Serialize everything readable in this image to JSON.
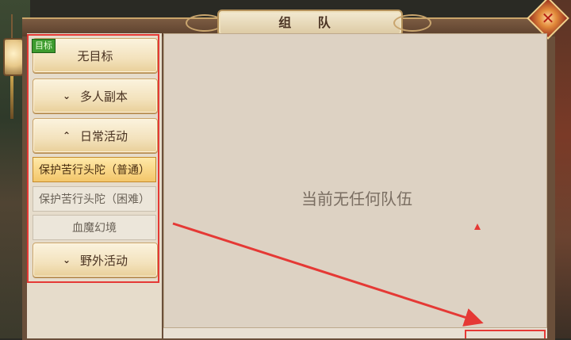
{
  "window": {
    "title": "组 队",
    "close_icon": "close-icon"
  },
  "left_menu": {
    "goal_tag": "目标",
    "items": [
      {
        "label": "无目标",
        "chevron": ""
      },
      {
        "label": "多人副本",
        "chevron": "⌄"
      },
      {
        "label": "日常活动",
        "chevron": "⌃"
      }
    ],
    "sub_items": [
      {
        "label": "保护苦行头陀（普通）",
        "selected": true
      },
      {
        "label": "保护苦行头陀（困难）",
        "selected": false
      },
      {
        "label": "血魔幻境",
        "selected": false
      }
    ],
    "last_item": {
      "label": "野外活动",
      "chevron": "⌄"
    }
  },
  "content": {
    "empty_message": "当前无任何队伍"
  },
  "colors": {
    "annotation_red": "#e53935",
    "selected_gold": "#f3c66a"
  }
}
